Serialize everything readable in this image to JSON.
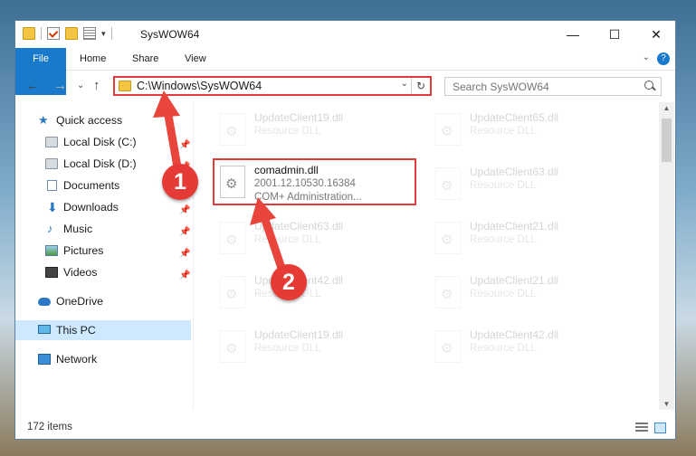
{
  "window": {
    "title": "SysWOW64",
    "controls": {
      "minimize": "—",
      "maximize": "☐",
      "close": "✕"
    }
  },
  "ribbon": {
    "tabs": [
      "File",
      "Home",
      "Share",
      "View"
    ],
    "help": "?",
    "collapse": "⌄"
  },
  "navigation": {
    "back": "←",
    "forward": "→",
    "recent": "⌄",
    "up": "↑",
    "address": "C:\\Windows\\SysWOW64",
    "address_dropdown": "⌄",
    "refresh": "↻",
    "search_placeholder": "Search SysWOW64"
  },
  "sidebar": {
    "items": [
      {
        "label": "Quick access",
        "icon": "star-icon",
        "pinned": false
      },
      {
        "label": "Local Disk (C:)",
        "icon": "disk-icon",
        "pinned": true
      },
      {
        "label": "Local Disk (D:)",
        "icon": "disk-icon",
        "pinned": true
      },
      {
        "label": "Documents",
        "icon": "documents-icon",
        "pinned": true
      },
      {
        "label": "Downloads",
        "icon": "downloads-icon",
        "pinned": true
      },
      {
        "label": "Music",
        "icon": "music-icon",
        "pinned": true
      },
      {
        "label": "Pictures",
        "icon": "pictures-icon",
        "pinned": true
      },
      {
        "label": "Videos",
        "icon": "videos-icon",
        "pinned": true
      },
      {
        "label": "OneDrive",
        "icon": "onedrive-icon",
        "pinned": false
      },
      {
        "label": "This PC",
        "icon": "this-pc-icon",
        "pinned": false,
        "selected": true
      },
      {
        "label": "Network",
        "icon": "network-icon",
        "pinned": false
      }
    ],
    "pin_glyph": "📌"
  },
  "files": {
    "left": [
      {
        "name": "UpdateClient19.dll",
        "type": "Resource DLL"
      },
      {
        "name": "comadmin.dll",
        "type": "2001.12.10530.16384",
        "desc": "COM+ Administration...",
        "highlighted": true
      },
      {
        "name": "UpdateClient63.dll",
        "type": "Resource DLL"
      },
      {
        "name": "UpdateClient42.dll",
        "type": "Resource DLL"
      },
      {
        "name": "UpdateClient19.dll",
        "type": "Resource DLL"
      }
    ],
    "right": [
      {
        "name": "UpdateClient65.dll",
        "type": "Resource DLL"
      },
      {
        "name": "UpdateClient63.dll",
        "type": "Resource DLL"
      },
      {
        "name": "UpdateClient21.dll",
        "type": "Resource DLL"
      },
      {
        "name": "UpdateClient21.dll",
        "type": "Resource DLL"
      },
      {
        "name": "UpdateClient42.dll",
        "type": "Resource DLL"
      }
    ]
  },
  "scrollbar": {
    "up": "▲",
    "down": "▼"
  },
  "status": {
    "item_count": "172 items"
  },
  "annotations": {
    "step1": "1",
    "step2": "2",
    "color": "#e53a35"
  }
}
